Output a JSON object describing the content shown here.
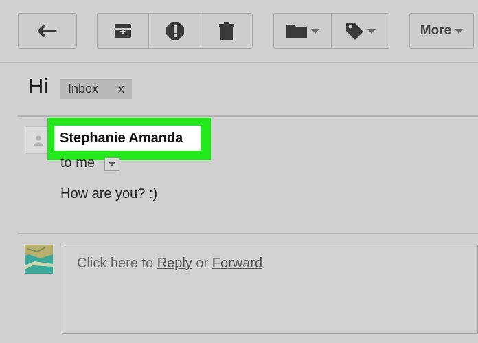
{
  "toolbar": {
    "back_icon": "reply-arrow-icon",
    "archive_icon": "archive-icon",
    "spam_icon": "report-spam-icon",
    "delete_icon": "trash-icon",
    "move_icon": "folder-icon",
    "labels_icon": "tag-icon",
    "more_label": "More"
  },
  "thread": {
    "subject": "Hi",
    "label_chip": {
      "name": "Inbox",
      "remove": "x"
    }
  },
  "message": {
    "sender": "Stephanie Amanda",
    "recipient_line": "to me",
    "body": "How are you? :)"
  },
  "reply": {
    "prefix": "Click here to ",
    "reply_link": "Reply",
    "joiner": " or ",
    "forward_link": "Forward"
  },
  "colors": {
    "background": "#d0d0d0",
    "highlight": "#22e81c",
    "sender_bg": "#ffffff"
  }
}
